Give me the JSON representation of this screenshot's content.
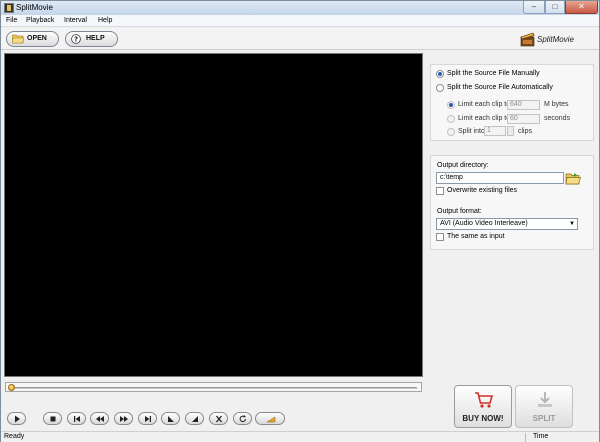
{
  "window": {
    "title": "SplitMovie",
    "minimize": "–",
    "maximize": "□",
    "close": "✕"
  },
  "menu": [
    "File",
    "Playback",
    "Interval",
    "Help"
  ],
  "toolbar": {
    "open_label": "OPEN",
    "help_label": "HELP",
    "brand": "SplitMovie"
  },
  "split_panel": {
    "manual_label": "Split the Source File Manually",
    "auto_label": "Split the Source File Automatically",
    "limit_mb_label": "Limit each clip to",
    "limit_mb_value": "640",
    "limit_mb_unit": "M bytes",
    "limit_sec_label": "Limit each clip to",
    "limit_sec_value": "60",
    "limit_sec_unit": "seconds",
    "split_into_label": "Split into",
    "split_into_value": "1",
    "split_into_unit": "clips",
    "selected_mode": "manual"
  },
  "output_panel": {
    "dir_label": "Output directory:",
    "dir_value": "c:\\temp",
    "overwrite_label": "Overwrite existing files",
    "format_label": "Output format:",
    "format_value": "AVI (Audio Video Interleave)",
    "same_as_input_label": "The same as input"
  },
  "seek": {
    "position": 0.0
  },
  "buttons": {
    "buy_label": "BUY NOW!",
    "split_label": "SPLIT"
  },
  "status": {
    "left": "Ready",
    "right": "Time"
  },
  "colors": {
    "video_bg": "#000000",
    "accent": "#2a5db0",
    "window_bg": "#f0f0f0"
  }
}
